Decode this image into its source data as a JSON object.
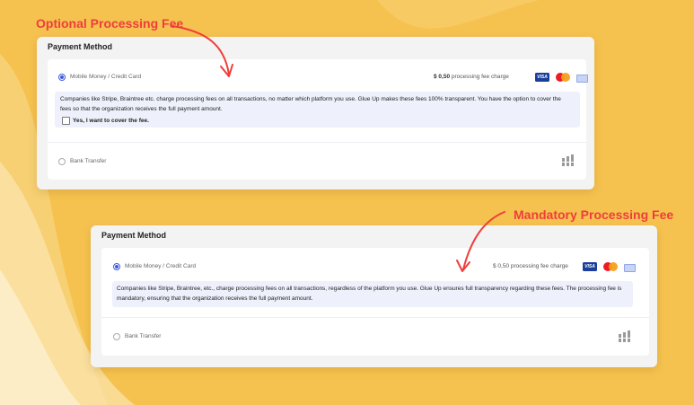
{
  "annotations": {
    "optional": "Optional Processing Fee",
    "mandatory": "Mandatory Processing Fee"
  },
  "colors": {
    "background": "#f6c24f",
    "annotation": "#ee3e3b",
    "accent": "#3d5be0",
    "info_bg": "#eef1fb"
  },
  "optional_card": {
    "title": "Payment Method",
    "mobile_option": "Mobile Money / Credit Card",
    "fee_amount": "$ 0,50",
    "fee_text": "processing fee charge",
    "visa_label": "VISA",
    "info_text": "Companies like Stripe, Braintree etc. charge processing fees on all transactions, no matter which platform you use. Glue Up makes these fees 100% transparent. You have the option to cover the fees so that the organization receives the full payment amount.",
    "checkbox_label": "Yes, I want to cover the fee.",
    "bank_option": "Bank Transfer"
  },
  "mandatory_card": {
    "title": "Payment Method",
    "mobile_option": "Mobile Money / Credit Card",
    "fee_text": "$ 0,50 processing fee charge",
    "visa_label": "VISA",
    "info_text": "Companies like Stripe, Braintree, etc., charge processing fees on all transactions, regardless of the platform you use. Glue Up ensures full transparency regarding these fees. The processing fee is mandatory, ensuring that the organization receives the full payment amount.",
    "bank_option": "Bank Transfer"
  },
  "icons": [
    "visa-icon",
    "mastercard-icon",
    "amex-icon",
    "bank-icon",
    "arrow-icon"
  ]
}
